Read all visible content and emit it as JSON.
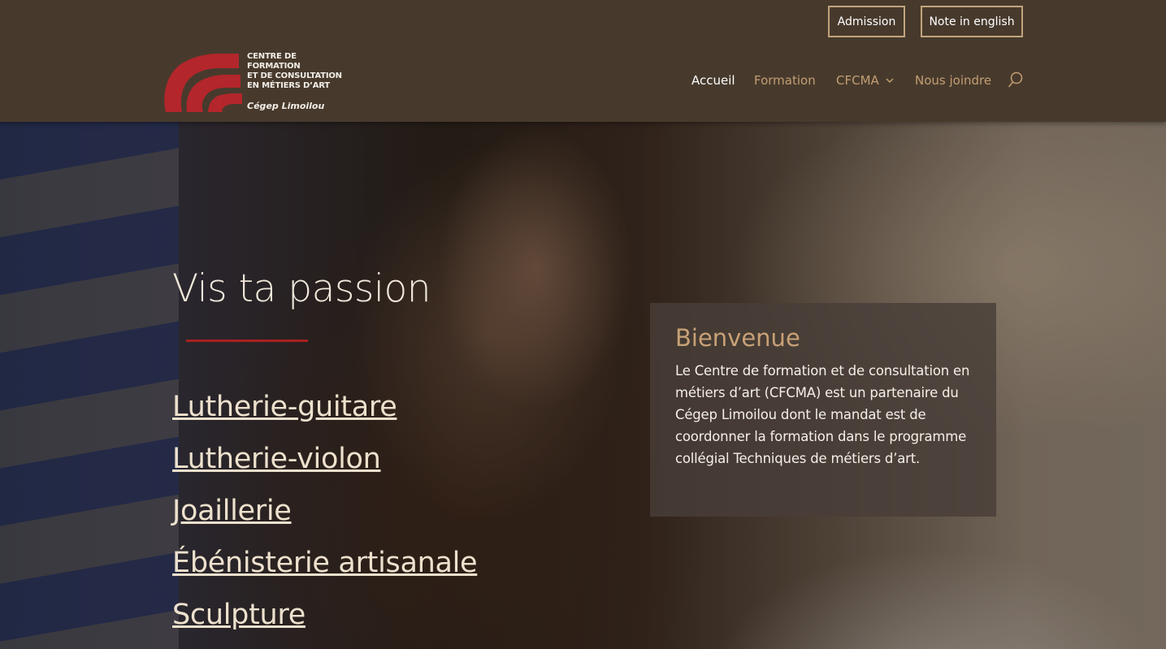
{
  "header": {
    "buttons": {
      "admission": "Admission",
      "english": "Note in english"
    },
    "logo": {
      "line1": "CENTRE DE FORMATION",
      "line2": "ET DE CONSULTATION",
      "line3": "EN MÉTIERS D’ART",
      "sub": "Cégep Limoilou"
    },
    "nav": [
      {
        "label": "Accueil",
        "active": true
      },
      {
        "label": "Formation",
        "active": false
      },
      {
        "label": "CFCMA",
        "active": false,
        "has_dropdown": true
      },
      {
        "label": "Nous joindre",
        "active": false
      }
    ],
    "search_icon": "search-icon",
    "colors": {
      "header_bg": "#473a2d",
      "nav_link": "#c49e72",
      "nav_active": "#ffffff",
      "button_border": "#c2a47c"
    }
  },
  "hero": {
    "title": "Vis ta passion",
    "programs": [
      "Lutherie-guitare",
      "Lutherie-violon",
      "Joaillerie",
      "Ébénisterie artisanale",
      "Sculpture"
    ],
    "welcome": {
      "heading": "Bienvenue",
      "text": "Le Centre de formation et de consultation en métiers d’art (CFCMA) est un partenaire du Cégep Limoilou dont le mandat est de coordonner la formation dans le programme collégial Techniques de métiers d’art."
    },
    "colors": {
      "accent_rule": "#a8201f",
      "welcome_heading": "#c8a176",
      "logo_red": "#b3262b"
    }
  }
}
